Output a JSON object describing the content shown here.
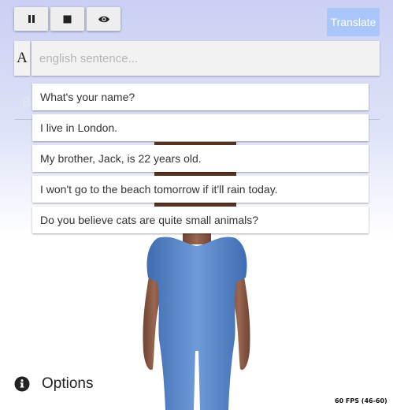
{
  "toolbar": {
    "pause_icon": "pause-icon",
    "stop_icon": "stop-icon",
    "eye_icon": "eye-icon",
    "translate_label": "Translate"
  },
  "input": {
    "language_label": "A",
    "placeholder": "english sentence...",
    "value": ""
  },
  "output": {
    "partial_text": "BS"
  },
  "suggestions": [
    "What's your name?",
    "I live in London.",
    "My brother, Jack, is 22 years old.",
    "I won't go to the beach tomorrow if it'll rain today.",
    "Do you believe cats are quite small animals?"
  ],
  "options": {
    "label": "Options",
    "icon": "info-icon"
  },
  "status": {
    "fps": "60 FPS (46-60)"
  },
  "colors": {
    "translate_button": "#a9c5fa",
    "avatar_body": "#5b87c9",
    "avatar_skin": "#8a5a45",
    "avatar_hair": "#5a3320"
  }
}
